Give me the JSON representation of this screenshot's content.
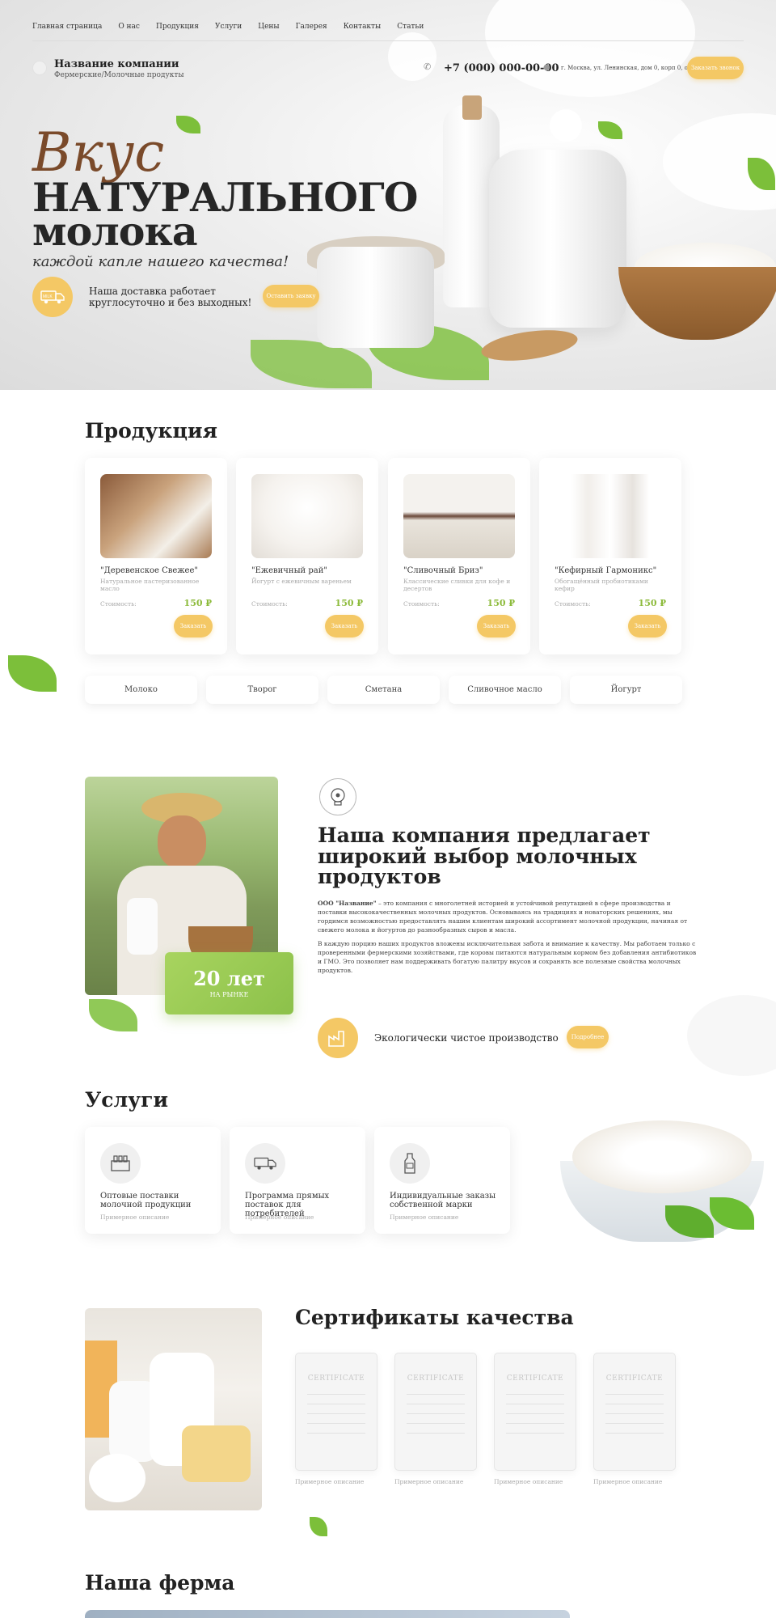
{
  "nav": {
    "items": [
      "Главная страница",
      "О нас",
      "Продукция",
      "Услуги",
      "Цены",
      "Галерея",
      "Контакты",
      "Статьи"
    ]
  },
  "header": {
    "company_name": "Название компании",
    "company_sub": "Фермерские/Молочные продукты",
    "phone": "+7 (000) 000-00-00",
    "address": "г. Москва, ул. Ленинская, дом 0, корп 0, офис 0",
    "callback_button": "Заказать звонок"
  },
  "hero": {
    "line1": "Вкус",
    "line2": "НАТУРАЛЬНОГО",
    "line3": "молока",
    "tagline": "каждой капле нашего качества!",
    "delivery_text": "Наша доставка работает круглосуточно и без выходных!",
    "delivery_badge": "MILK",
    "order_button": "Оставить заявку"
  },
  "products": {
    "title": "Продукция",
    "cost_label": "Стоимость:",
    "order_label": "Заказать",
    "items": [
      {
        "name": "\"Деревенское Свежее\"",
        "desc": "Натуральное пастеризованное масло",
        "price": "150 ₽"
      },
      {
        "name": "\"Ежевичный рай\"",
        "desc": "Йогурт с ежевичным вареньем",
        "price": "150 ₽"
      },
      {
        "name": "\"Сливочный Бриз\"",
        "desc": "Классические сливки для кофе и десертов",
        "price": "150 ₽"
      },
      {
        "name": "\"Кефирный Гармоникс\"",
        "desc": "Обогащённый пробиотиками кефир",
        "price": "150 ₽"
      }
    ],
    "categories": [
      "Молоко",
      "Творог",
      "Сметана",
      "Сливочное масло",
      "Йогурт"
    ]
  },
  "about": {
    "years": "20 лет",
    "years_sub": "НА РЫНКЕ",
    "title": "Наша компания предлагает широкий выбор молочных продуктов",
    "p1_bold": "ООО \"Название\"",
    "p1": " – это компания с многолетней историей и устойчивой репутацией в сфере производства и поставки высококачественных молочных продуктов. Основываясь на традициях и новаторских решениях, мы гордимся возможностью предоставлять нашим клиентам широкий ассортимент молочной продукции, начиная от свежего молока и йогуртов до разнообразных сыров и масла.",
    "p2": "В каждую порцию наших продуктов вложены исключительная забота и внимание к качеству. Мы работаем только с проверенными фермерскими хозяйствами, где коровы питаются натуральным кормом без добавления антибиотиков и ГМО. Это позволяет нам поддерживать богатую палитру вкусов и сохранять все полезные свойства молочных продуктов.",
    "eco_text": "Экологически чистое производство",
    "more_button": "Подробнее"
  },
  "services": {
    "title": "Услуги",
    "items": [
      {
        "title": "Оптовые поставки молочной продукции",
        "desc": "Примерное описание",
        "icon": "milk-crate-icon"
      },
      {
        "title": "Программа прямых поставок для потребителей",
        "desc": "Примерное описание",
        "icon": "delivery-truck-icon"
      },
      {
        "title": "Индивидуальные заказы собственной марки",
        "desc": "Примерное описание",
        "icon": "milk-bottle-icon"
      }
    ]
  },
  "certificates": {
    "title": "Сертификаты качества",
    "card_heading": "CERTIFICATE",
    "items": [
      {
        "caption": "Примерное описание"
      },
      {
        "caption": "Примерное описание"
      },
      {
        "caption": "Примерное описание"
      },
      {
        "caption": "Примерное описание"
      }
    ]
  },
  "farm": {
    "title": "Наша ферма"
  },
  "colors": {
    "accent_yellow": "#f4c865",
    "accent_green": "#8cc14a",
    "brown_script": "#7a4a2a",
    "text_dark": "#222222"
  }
}
